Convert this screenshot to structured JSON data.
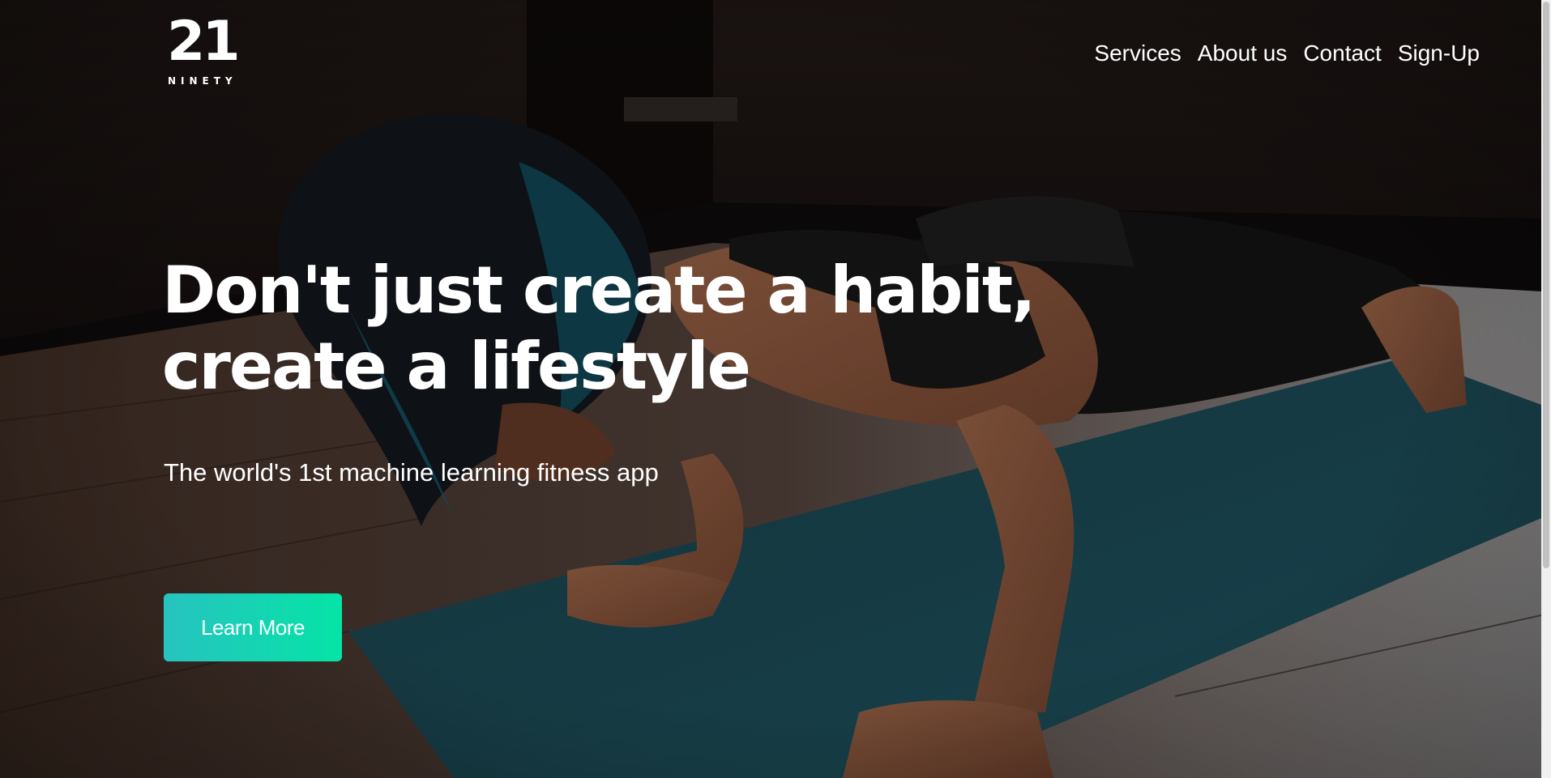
{
  "brand": {
    "logo_number": "21",
    "logo_word": "NINETY"
  },
  "nav": {
    "items": [
      {
        "label": "Services"
      },
      {
        "label": "About us"
      },
      {
        "label": "Contact"
      },
      {
        "label": "Sign-Up"
      }
    ]
  },
  "hero": {
    "headline_line1": "Don't just create a habit,",
    "headline_line2": "create a lifestyle",
    "subtitle": "The world's 1st machine learning fitness app",
    "cta_label": "Learn More"
  },
  "colors": {
    "cta_gradient_start": "#27c3c0",
    "cta_gradient_end": "#05e4a6",
    "text": "#ffffff",
    "mat": "#163c45"
  }
}
